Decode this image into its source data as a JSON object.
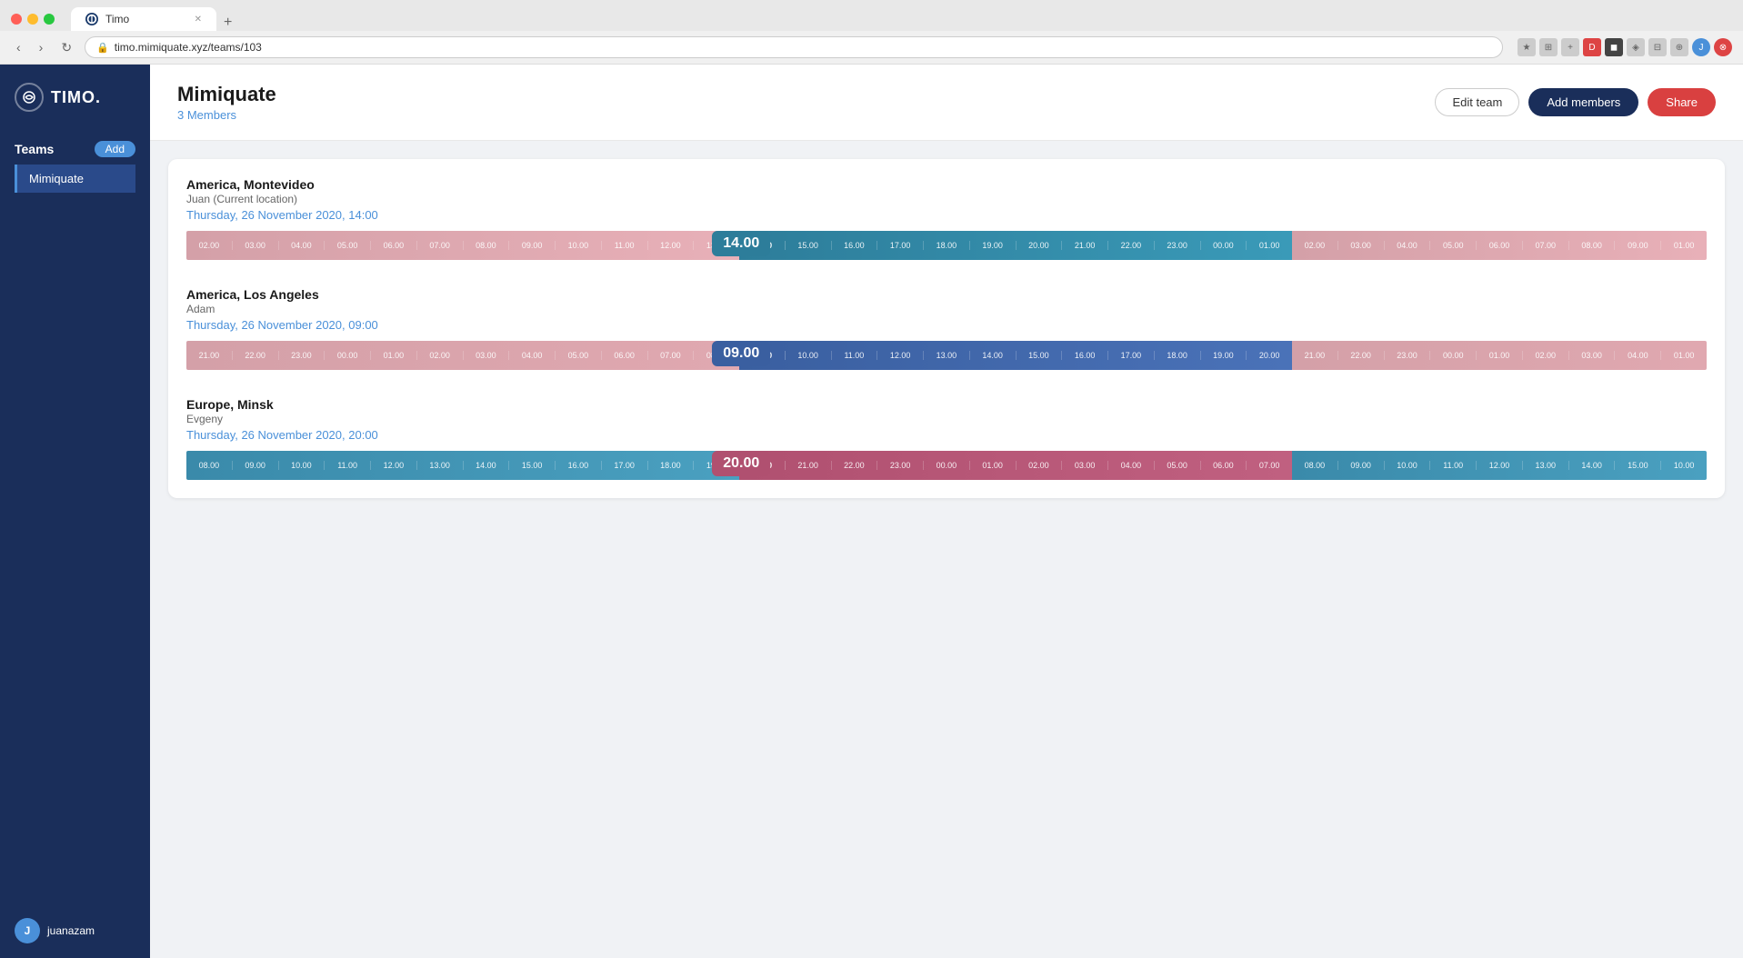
{
  "browser": {
    "tab_title": "Timo",
    "url": "timo.mimiquate.xyz/teams/103",
    "new_tab_label": "+",
    "nav": {
      "back": "‹",
      "forward": "›",
      "refresh": "↻"
    }
  },
  "sidebar": {
    "logo_text": "TIMO.",
    "sections": [
      {
        "title": "Teams",
        "add_button": "Add",
        "items": [
          {
            "label": "Mimiquate",
            "active": true
          }
        ]
      }
    ],
    "user": {
      "name": "juanazam",
      "initials": "J"
    }
  },
  "header": {
    "team_name": "Mimiquate",
    "members_count": "3 Members",
    "edit_team_label": "Edit team",
    "add_members_label": "Add members",
    "share_label": "Share"
  },
  "timezones": [
    {
      "location": "America, Montevideo",
      "person": "Juan (Current location)",
      "datetime": "Thursday, 26 November 2020, 14:00",
      "current_time": "14.00",
      "badge_color": "teal",
      "indicator_position_pct": 36.5,
      "hours": [
        "02.00",
        "03.00",
        "04.00",
        "05.00",
        "06.00",
        "07.00",
        "08.00",
        "09.00",
        "10.00",
        "11.00",
        "12.00",
        "13.00",
        "14.00",
        "15.00",
        "16.00",
        "17.00",
        "18.00",
        "19.00",
        "20.00",
        "21.00",
        "22.00",
        "23.00",
        "00.00",
        "01.00",
        "02.00",
        "03.00",
        "04.00",
        "05.00",
        "06.00",
        "07.00",
        "08.00",
        "09.00",
        "01.00"
      ],
      "segment_style": "montevideo"
    },
    {
      "location": "America, Los Angeles",
      "person": "Adam",
      "datetime": "Thursday, 26 November 2020, 09:00",
      "current_time": "09.00",
      "badge_color": "blue",
      "indicator_position_pct": 36.5,
      "hours": [
        "21.00",
        "22.00",
        "23.00",
        "00.00",
        "01.00",
        "02.00",
        "03.00",
        "04.00",
        "05.00",
        "06.00",
        "07.00",
        "08.00",
        "09.00",
        "10.00",
        "11.00",
        "12.00",
        "13.00",
        "14.00",
        "15.00",
        "16.00",
        "17.00",
        "18.00",
        "19.00",
        "20.00",
        "21.00",
        "22.00",
        "23.00",
        "00.00",
        "01.00",
        "02.00",
        "03.00",
        "04.00",
        "01.00"
      ],
      "segment_style": "losangeles"
    },
    {
      "location": "Europe, Minsk",
      "person": "Evgeny",
      "datetime": "Thursday, 26 November 2020, 20:00",
      "current_time": "20.00",
      "badge_color": "rose",
      "indicator_position_pct": 36.5,
      "hours": [
        "08.00",
        "09.00",
        "10.00",
        "11.00",
        "12.00",
        "13.00",
        "14.00",
        "15.00",
        "16.00",
        "17.00",
        "18.00",
        "19.00",
        "20.00",
        "21.00",
        "22.00",
        "23.00",
        "00.00",
        "01.00",
        "02.00",
        "03.00",
        "04.00",
        "05.00",
        "06.00",
        "07.00",
        "08.00",
        "09.00",
        "10.00",
        "11.00",
        "12.00",
        "13.00",
        "14.00",
        "15.00"
      ],
      "segment_style": "minsk"
    }
  ]
}
